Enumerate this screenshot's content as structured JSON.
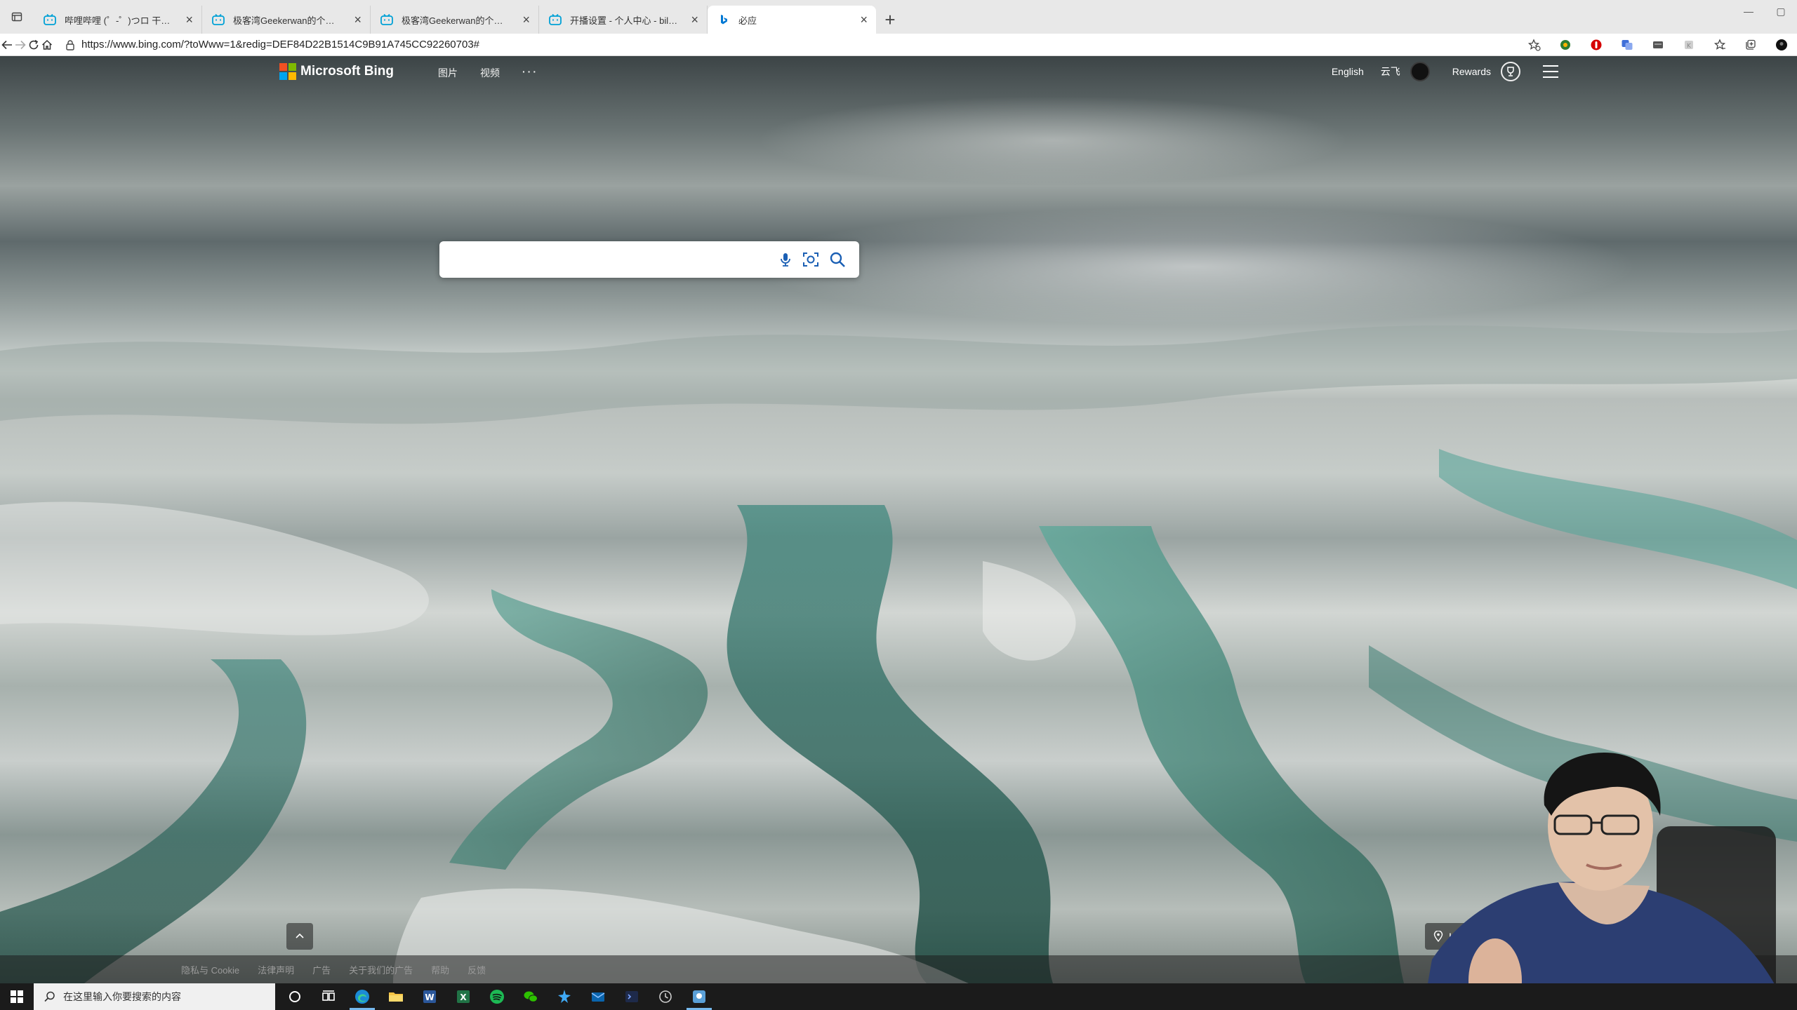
{
  "browser": {
    "tabs": [
      {
        "title": "哔哩哔哩 (゜-゜)つロ 干杯~-bilibili",
        "icon": "bilibili-icon",
        "active": false
      },
      {
        "title": "极客湾Geekerwan的个人空间 - 哔哩哔哩",
        "icon": "bilibili-icon",
        "active": false
      },
      {
        "title": "极客湾Geekerwan的个人空间 - 哔哩哔哩",
        "icon": "bilibili-icon",
        "active": false
      },
      {
        "title": "开播设置 - 个人中心 - bilibili link",
        "icon": "bilibili-icon",
        "active": false
      },
      {
        "title": "必应",
        "icon": "bing-icon",
        "active": true
      }
    ],
    "new_tab_label": "+",
    "close_glyph": "×",
    "url": "https://www.bing.com/?toWww=1&redig=DEF84D22B1514C9B91A745CC92260703#"
  },
  "bing": {
    "brand": "Microsoft Bing",
    "nav": {
      "images": "图片",
      "videos": "视频",
      "more": "···"
    },
    "language": "English",
    "username": "云飞",
    "rewards": "Rewards",
    "search_placeholder": "",
    "location_text": "In",
    "footer_links": [
      "隐私与 Cookie",
      "法律声明",
      "广告",
      "关于我们的广告",
      "帮助",
      "反馈"
    ]
  },
  "taskbar": {
    "search_placeholder": "在这里输入你要搜索的内容",
    "apps": [
      "cortana-icon",
      "task-view-icon",
      "edge-icon",
      "file-explorer-icon",
      "word-icon",
      "excel-icon",
      "spotify-icon",
      "wechat-icon",
      "app-icon",
      "mail-icon",
      "terminal-icon",
      "clock-icon",
      "active-app-icon"
    ]
  },
  "colors": {
    "bing_blue": "#0078d4",
    "ms_red": "#f25022",
    "ms_green": "#7fba00",
    "ms_blue": "#00a4ef",
    "ms_yellow": "#ffb900",
    "bilibili_blue": "#00a1d6"
  }
}
